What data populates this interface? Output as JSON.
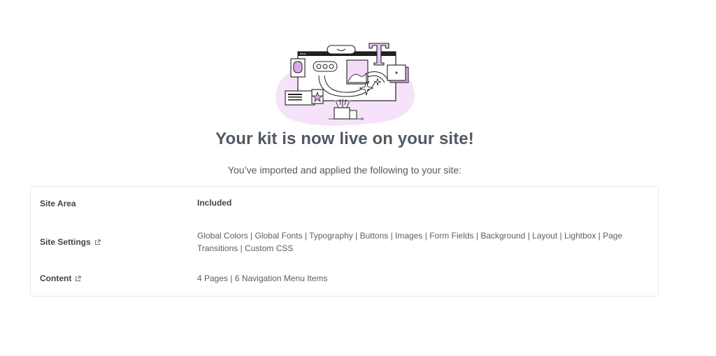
{
  "headline": "Your kit is now live on your site!",
  "subtitle": "You’ve imported and applied the following to your site:",
  "table": {
    "header": {
      "area": "Site Area",
      "included": "Included"
    },
    "rows": [
      {
        "area": "Site Settings",
        "icon": "external-link-icon",
        "included": "Global Colors | Global Fonts | Typography | Buttons | Images | Form Fields | Background | Layout | Lightbox | Page Transitions | Custom CSS"
      },
      {
        "area": "Content",
        "icon": "external-link-icon",
        "included": "4 Pages | 6 Navigation Menu Items"
      }
    ]
  },
  "colors": {
    "accent_pink": "#f3dcf7",
    "accent_purple": "#d9a9ea",
    "text_dark": "#515962",
    "border": "#e6e8ea"
  }
}
